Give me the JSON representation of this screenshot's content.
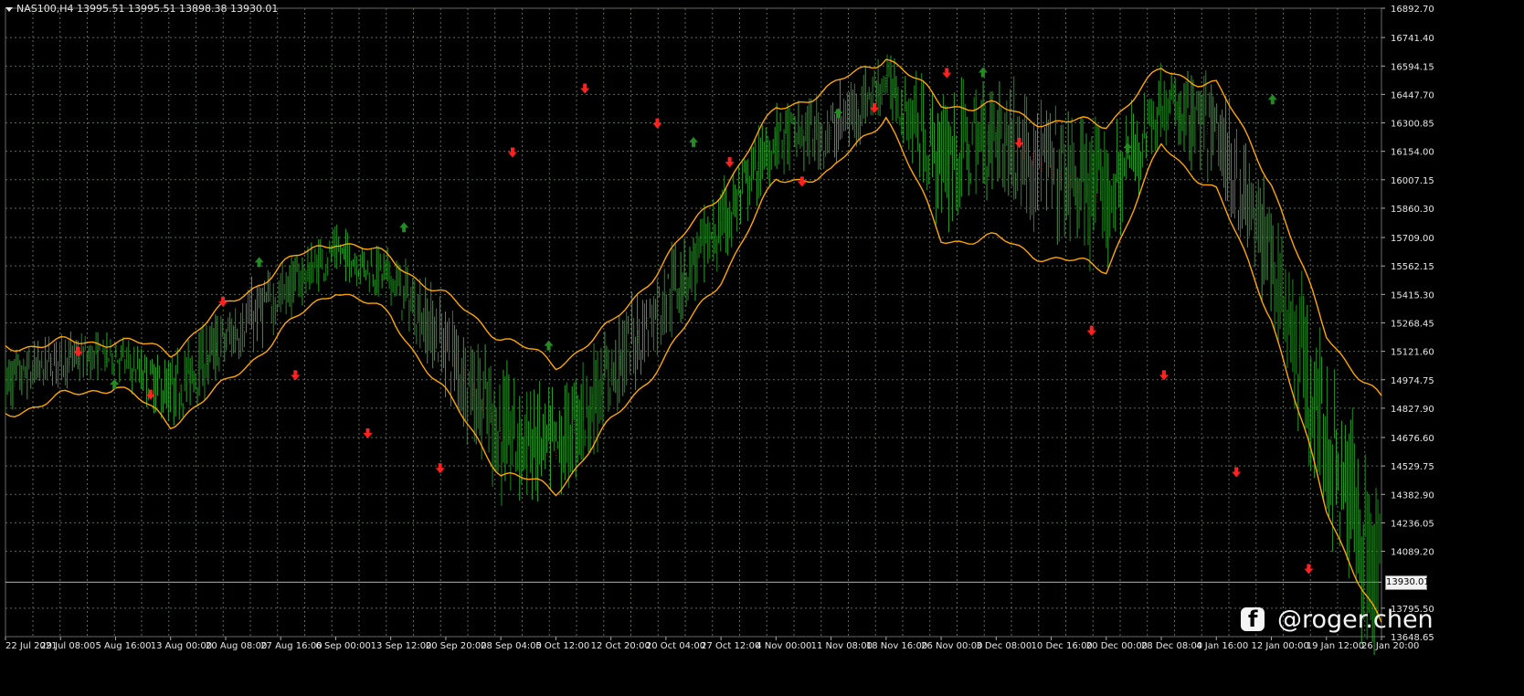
{
  "window": {
    "symbol_header": "NAS100,H4  13995.51 13995.51 13898.38 13930.01"
  },
  "price_axis": {
    "labels": [
      "16892.70",
      "16741.40",
      "16594.15",
      "16447.70",
      "16300.85",
      "16154.00",
      "16007.15",
      "15860.30",
      "15709.00",
      "15562.15",
      "15415.30",
      "15268.45",
      "15121.60",
      "14974.75",
      "14827.90",
      "14676.60",
      "14529.75",
      "14382.90",
      "14236.05",
      "14089.20",
      "13795.50",
      "13648.65"
    ],
    "current_price": "13930.01"
  },
  "time_axis": {
    "labels": [
      "22 Jul 2021",
      "29 Jul 08:00",
      "5 Aug 16:00",
      "13 Aug 00:00",
      "20 Aug 08:00",
      "27 Aug 16:00",
      "6 Sep 00:00",
      "13 Sep 12:00",
      "20 Sep 20:00",
      "28 Sep 04:00",
      "5 Oct 12:00",
      "12 Oct 20:00",
      "20 Oct 04:00",
      "27 Oct 12:00",
      "4 Nov 00:00",
      "11 Nov 08:00",
      "18 Nov 16:00",
      "26 Nov 00:00",
      "3 Dec 08:00",
      "10 Dec 16:00",
      "20 Dec 00:00",
      "28 Dec 08:00",
      "4 Jan 16:00",
      "12 Jan 00:00",
      "19 Jan 12:00",
      "26 Jan 20:00"
    ]
  },
  "watermark": {
    "text": "@roger.chen",
    "icon": "facebook-icon"
  },
  "colors": {
    "background": "#000000",
    "grid": "#5a6a5a",
    "candle_up": "#1f8a1f",
    "candle_down": "#2aa52a",
    "band": "#ffa500",
    "buy_arrow": "#228b22",
    "sell_arrow": "#ff2020",
    "ribbon_up": "#1e7a1e",
    "ribbon_down": "#a02020"
  },
  "chart_data": {
    "type": "line",
    "symbol": "NAS100",
    "timeframe": "H4",
    "ylim": [
      13648.65,
      16892.7
    ],
    "x": [
      "22 Jul 2021",
      "29 Jul 08:00",
      "5 Aug 16:00",
      "13 Aug 00:00",
      "20 Aug 08:00",
      "27 Aug 16:00",
      "6 Sep 00:00",
      "13 Sep 12:00",
      "20 Sep 20:00",
      "28 Sep 04:00",
      "5 Oct 12:00",
      "12 Oct 20:00",
      "20 Oct 04:00",
      "27 Oct 12:00",
      "4 Nov 00:00",
      "11 Nov 08:00",
      "18 Nov 16:00",
      "26 Nov 00:00",
      "3 Dec 08:00",
      "10 Dec 16:00",
      "20 Dec 00:00",
      "28 Dec 08:00",
      "4 Jan 16:00",
      "12 Jan 00:00",
      "19 Jan 12:00",
      "26 Jan 20:00"
    ],
    "series": [
      {
        "values": [
          14950,
          15080,
          15100,
          14900,
          15180,
          15420,
          15640,
          15500,
          15150,
          14700,
          14600,
          15000,
          15400,
          15760,
          16220,
          16250,
          16520,
          16100,
          16250,
          16050,
          15900,
          16400,
          16250,
          15600,
          14650,
          13930
        ]
      },
      {
        "values": [
          15150,
          15160,
          15180,
          15120,
          15350,
          15560,
          15700,
          15600,
          15400,
          15200,
          15050,
          15250,
          15600,
          15950,
          16370,
          16480,
          16650,
          16400,
          16380,
          16300,
          16300,
          16570,
          16500,
          16000,
          15200,
          14870
        ]
      },
      {
        "values": [
          14800,
          14880,
          14950,
          14750,
          14950,
          15220,
          15450,
          15300,
          14900,
          14500,
          14400,
          14750,
          15100,
          15500,
          16000,
          16040,
          16350,
          15700,
          15700,
          15600,
          15550,
          16180,
          15950,
          15300,
          14300,
          13700
        ]
      }
    ],
    "sell_signals": [
      15121.6,
      14900,
      15380,
      15000,
      14700,
      14520,
      16150,
      16480,
      16300,
      16100,
      16000,
      16380,
      16560,
      16200,
      15230,
      15000,
      14500,
      14000
    ],
    "buy_signals": [
      14950,
      15580,
      15760,
      15150,
      16200,
      16350,
      16560,
      16170,
      16420
    ],
    "grid": true
  }
}
